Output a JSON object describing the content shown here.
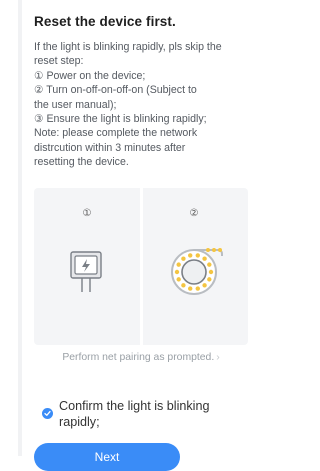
{
  "title": "Reset the device first.",
  "description_lines": [
    "If the light is blinking rapidly, pls skip the",
    "reset step:",
    "① Power on the device;",
    "② Turn on-off-on-off-on (Subject to",
    "the user manual);",
    "③ Ensure the light is blinking rapidly;",
    "Note: please complete the network",
    "distrcution within 3 minutes after",
    "resetting the device."
  ],
  "illustration": {
    "step_1_label": "①",
    "step_2_label": "②",
    "step_1_icon": "power-plug-icon",
    "step_2_icon": "blinking-light-ring-icon"
  },
  "pair_link": {
    "label": "Perform net pairing as prompted.",
    "chevron": "›"
  },
  "confirm": {
    "checked": true,
    "label": "Confirm the light is blinking rapidly;"
  },
  "next_button": {
    "label": "Next"
  },
  "colors": {
    "accent": "#3a8cf7",
    "led_yellow": "#f4c542",
    "illustration_bg": "#f4f5f7"
  }
}
